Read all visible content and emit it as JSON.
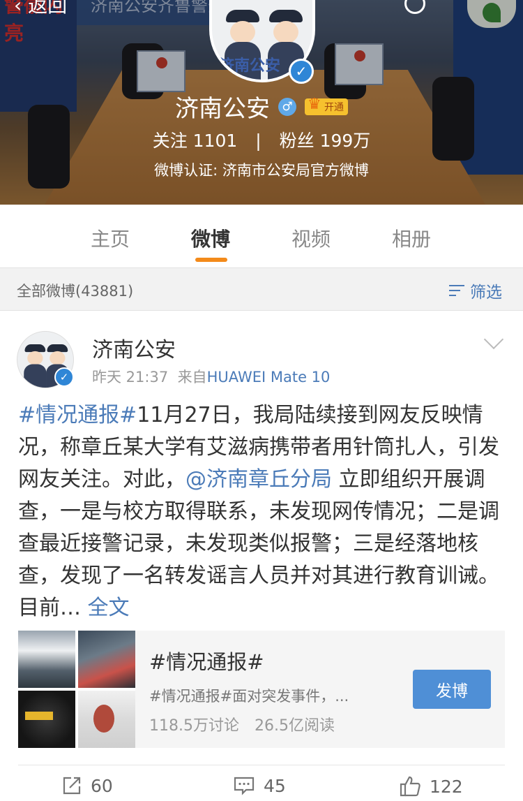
{
  "header": {
    "back_label": "返回",
    "cover_text_left": "警徽闪亮",
    "cover_text_top": "济南公安齐鲁警务",
    "avatar_text": "济南公安",
    "profile_name": "济南公安",
    "gender_symbol": "♂",
    "vip_label": "开通",
    "verify_symbol": "✓",
    "follow_label": "关注",
    "follow_count": "1101",
    "separator": "|",
    "fans_label": "粉丝",
    "fans_count": "199万",
    "verification": "微博认证: 济南市公安局官方微博"
  },
  "tabs": [
    {
      "label": "主页",
      "active": false
    },
    {
      "label": "微博",
      "active": true
    },
    {
      "label": "视频",
      "active": false
    },
    {
      "label": "相册",
      "active": false
    }
  ],
  "filter": {
    "count_label": "全部微博(43881)",
    "filter_label": "筛选"
  },
  "post": {
    "author": "济南公安",
    "time": "昨天 21:37",
    "source_prefix": "来自",
    "source": "HUAWEI Mate 10",
    "hashtag": "#情况通报#",
    "text_part1": "11月27日，我局陆续接到网友反映情况，称章丘某大学有艾滋病携带者用针筒扎人，引发网友关注。对此，",
    "mention": "@济南章丘分局",
    "text_part2": " 立即组织开展调查，一是与校方取得联系，未发现网传情况；二是调查最近接警记录，未发现类似报警；三是经落地核查，发现了一名转发谣言人员并对其进行教育训诫。目前… ",
    "full_text_link": "全文"
  },
  "topic": {
    "title": "#情况通报#",
    "description": "#情况通报#面对突发事件，...",
    "discussions": "118.5万讨论",
    "reads": "26.5亿阅读",
    "button_label": "发博"
  },
  "actions": {
    "repost_count": "60",
    "comment_count": "45",
    "like_count": "122"
  },
  "colors": {
    "link": "#4b7bb8",
    "tab_indicator": "#f38a1a",
    "button": "#4f8fd6",
    "verified_badge": "#2f86d6"
  }
}
